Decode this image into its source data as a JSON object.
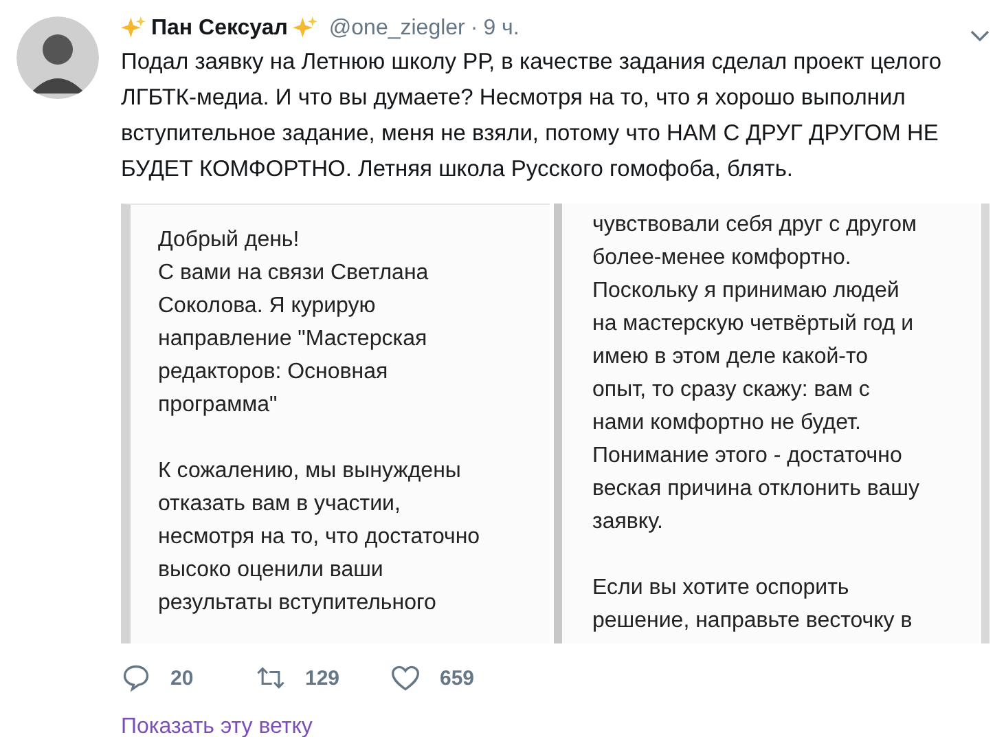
{
  "tweet": {
    "name": "Пан Сексуал",
    "handle": "@one_ziegler",
    "separator": "·",
    "time": "9 ч.",
    "text": "Подал заявку на Летнюю школу РР, в качестве задания сделал проект целого\nЛГБТК-медиа. И что вы думаете? Несмотря на то, что я хорошо выполнил\nвступительное задание, меня не взяли, потому что НАМ С ДРУГ ДРУГОМ НЕ\nБУДЕТ КОМФОРТНО. Летняя школа Русского гомофоба, блять.",
    "images": [
      {
        "paragraphs": [
          "Добрый день!\nС вами на связи Светлана\nСоколова. Я курирую\nнаправление \"Мастерская\nредакторов: Основная\nпрограмма\"",
          "К сожалению, мы вынуждены\nотказать вам в участии,\nнесмотря на то, что достаточно\nвысоко оценили ваши\nрезультаты вступительного"
        ]
      },
      {
        "paragraphs": [
          "чувствовали себя друг с другом\nболее-менее комфортно.\nПоскольку я принимаю людей\nна мастерскую четвёртый год и\nимею в этом деле какой-то\nопыт, то сразу скажу: вам с\nнами комфортно не будет.\nПонимание этого - достаточно\nвеская причина отклонить вашу\nзаявку.",
          "Если вы хотите оспорить\nрешение, направьте весточку в"
        ]
      }
    ],
    "actions": [
      {
        "kind": "reply",
        "count": "20"
      },
      {
        "kind": "retweet",
        "count": "129"
      },
      {
        "kind": "like",
        "count": "659"
      }
    ],
    "thread_link": "Показать эту ветку"
  }
}
